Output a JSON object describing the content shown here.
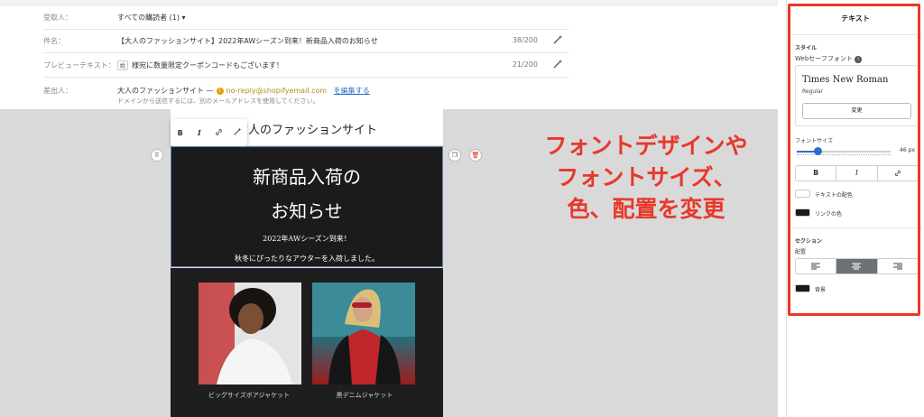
{
  "form": {
    "recipient": {
      "label": "受取人：",
      "value": "すべての購読者 (1) ▾"
    },
    "subject": {
      "label": "件名：",
      "value": "【大人のファッションサイト】2022年AWシーズン到来！新商品入荷のお知らせ",
      "count": "38/200"
    },
    "preview": {
      "label": "プレビューテキスト：",
      "chip": "姓",
      "value": "様宛に数量限定クーポンコードもございます！",
      "count": "21/200"
    },
    "sender": {
      "label": "差出人：",
      "name": "大人のファッションサイト —",
      "email": "no-reply@shopifyemail.com",
      "edit_link": "を編集する",
      "note": "ドメインから送信するには、別のメールアドレスを使用してください。"
    }
  },
  "email": {
    "shop_title": "大人のファッションサイト",
    "toolbar": {
      "bold": "B",
      "italic": "I"
    },
    "hero": {
      "line1": "新商品入荷の",
      "line2": "お知らせ",
      "para1": "2022年AWシーズン到来！",
      "para2": "秋冬にぴったりなアウターを入荷しました。"
    },
    "products": [
      {
        "caption": "ビッグサイズボアジャケット"
      },
      {
        "caption": "黒デニムジャケット"
      }
    ]
  },
  "annotation": {
    "lines": [
      "フォントデザインや",
      "フォントサイズ、",
      "色、配置を変更"
    ],
    "color": "#e8382a"
  },
  "panel": {
    "title": "テキスト",
    "style_heading": "スタイル",
    "font_label": "Webセーフフォント",
    "font_name": "Times New Roman",
    "font_style": "Regular",
    "change_button": "変更",
    "size_label": "フォントサイズ",
    "size_value": "46 px",
    "size_fraction": 0.22,
    "format": {
      "bold": "B",
      "italic": "I"
    },
    "text_color_label": "テキストの配色",
    "text_color": "#ffffff",
    "link_color_label": "リンクの色",
    "link_color": "#1a1a1a",
    "section_heading": "セクション",
    "align_label": "配置",
    "alignment": "center",
    "background_label": "背景",
    "background_color": "#1a1a1a",
    "accent": "#2c6ecb"
  }
}
